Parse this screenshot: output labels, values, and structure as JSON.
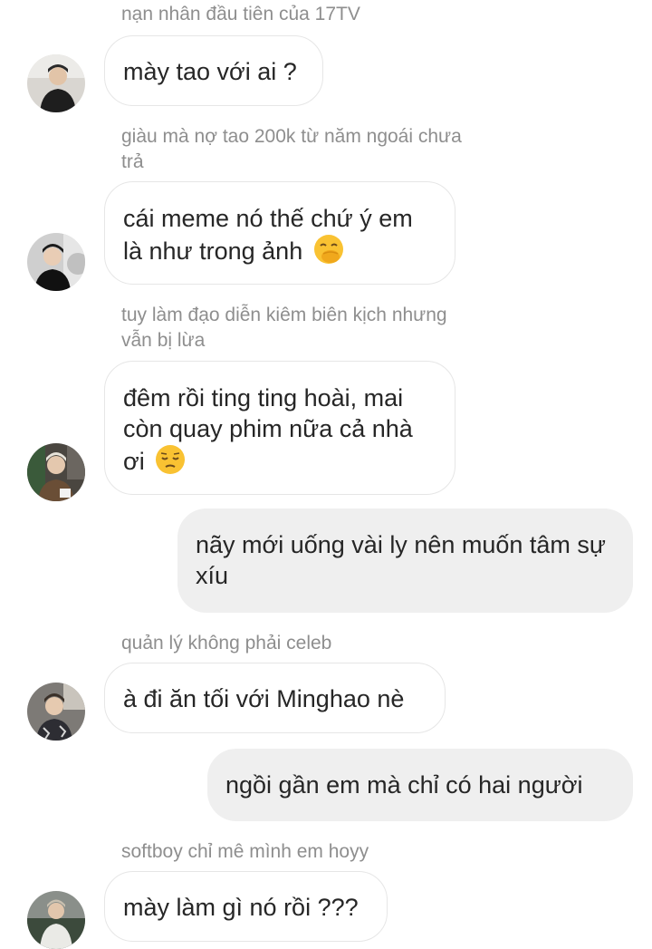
{
  "messages": [
    {
      "type": "in",
      "sender": "nạn nhân đầu tiên của 17TV",
      "text": "mày tao với ai ?",
      "emoji": ""
    },
    {
      "type": "in",
      "sender": "giàu mà nợ tao 200k từ năm ngoái chưa trả",
      "text": "cái meme nó thế chứ ý em là như trong ảnh",
      "emoji": "hand-over-mouth-emoji"
    },
    {
      "type": "in",
      "sender": "tuy làm đạo diễn kiêm biên kịch nhưng vẫn bị lừa",
      "text": "đêm rồi ting ting hoài, mai còn quay phim nữa cả nhà ơi",
      "emoji": "pensive-emoji"
    },
    {
      "type": "out",
      "sender": "",
      "text": "nãy mới uống vài ly nên muốn tâm sự xíu",
      "emoji": ""
    },
    {
      "type": "in",
      "sender": "quản lý không phải celeb",
      "text": "à đi ăn tối với Minghao nè",
      "emoji": ""
    },
    {
      "type": "out",
      "sender": "",
      "text": "ngồi gần em mà chỉ có hai người",
      "emoji": ""
    },
    {
      "type": "in",
      "sender": "softboy chỉ mê mình em hoyy",
      "text": "mày làm gì nó rồi ???",
      "emoji": ""
    }
  ],
  "colors": {
    "incoming_bg": "#ffffff",
    "incoming_border": "#e6e6e6",
    "outgoing_bg": "#efefef",
    "sender_text": "#8e8e8e",
    "message_text": "#262626",
    "emoji_face": "#f9c232"
  }
}
